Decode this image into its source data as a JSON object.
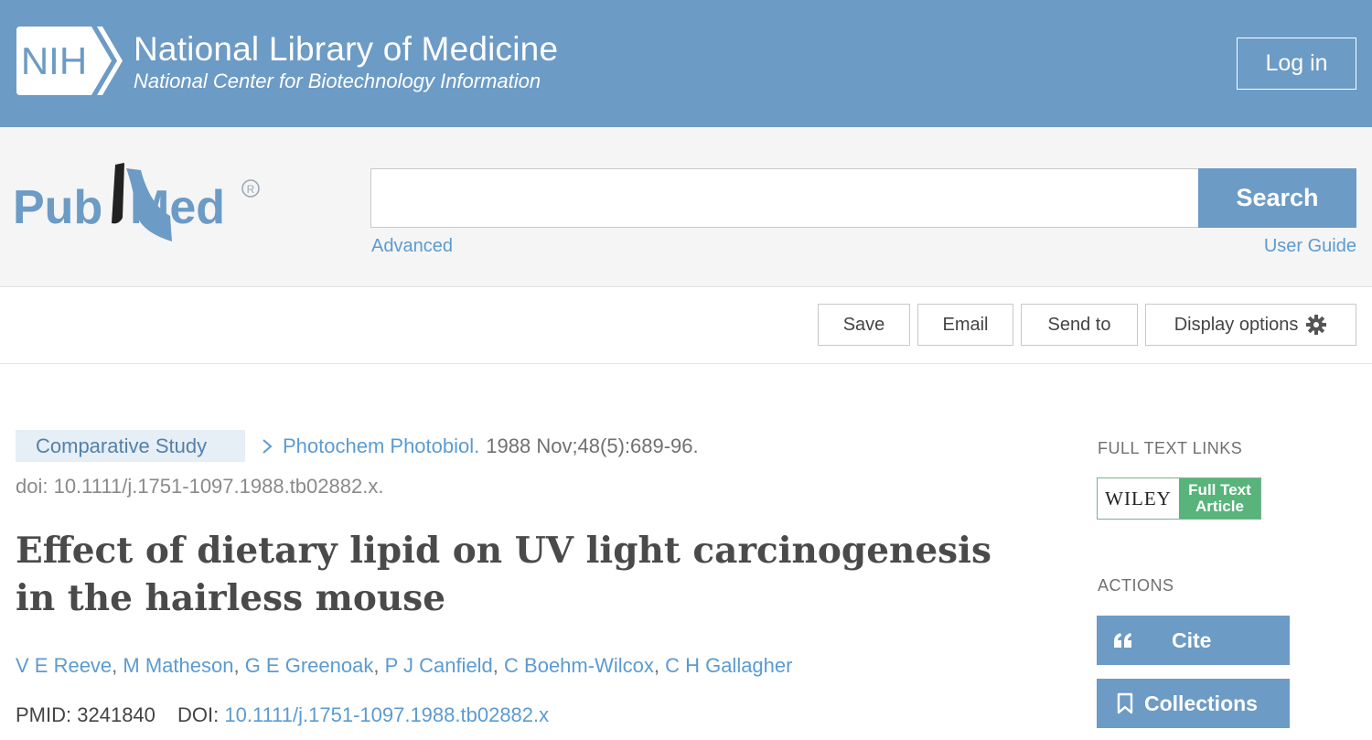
{
  "header": {
    "logo_text": "NIH",
    "title": "National Library of Medicine",
    "subtitle": "National Center for Biotechnology Information",
    "login_label": "Log in"
  },
  "search": {
    "logo_text": "PubMed",
    "query": "",
    "button_label": "Search",
    "advanced_label": "Advanced",
    "user_guide_label": "User Guide"
  },
  "toolbar": {
    "save_label": "Save",
    "email_label": "Email",
    "send_to_label": "Send to",
    "display_options_label": "Display options"
  },
  "article": {
    "publication_type": "Comparative Study",
    "journal": "Photochem Photobiol.",
    "citation": "1988 Nov;48(5):689-96.",
    "doi_line": "doi: 10.1111/j.1751-1097.1988.tb02882.x.",
    "title": "Effect of dietary lipid on UV light carcinogenesis in the hairless mouse",
    "authors": [
      "V E Reeve",
      "M Matheson",
      "G E Greenoak",
      "P J Canfield",
      "C Boehm-Wilcox",
      "C H Gallagher"
    ],
    "pmid_label": "PMID:",
    "pmid": "3241840",
    "doi_label": "DOI:",
    "doi": "10.1111/j.1751-1097.1988.tb02882.x"
  },
  "sidebar": {
    "full_text_heading": "FULL TEXT LINKS",
    "publisher": "WILEY",
    "full_text_line1": "Full Text",
    "full_text_line2": "Article",
    "actions_heading": "ACTIONS",
    "cite_label": "Cite",
    "collections_label": "Collections"
  },
  "colors": {
    "nih_blue": "#6c9bc5",
    "link_blue": "#5b9bd1",
    "wiley_green": "#58b47a"
  }
}
